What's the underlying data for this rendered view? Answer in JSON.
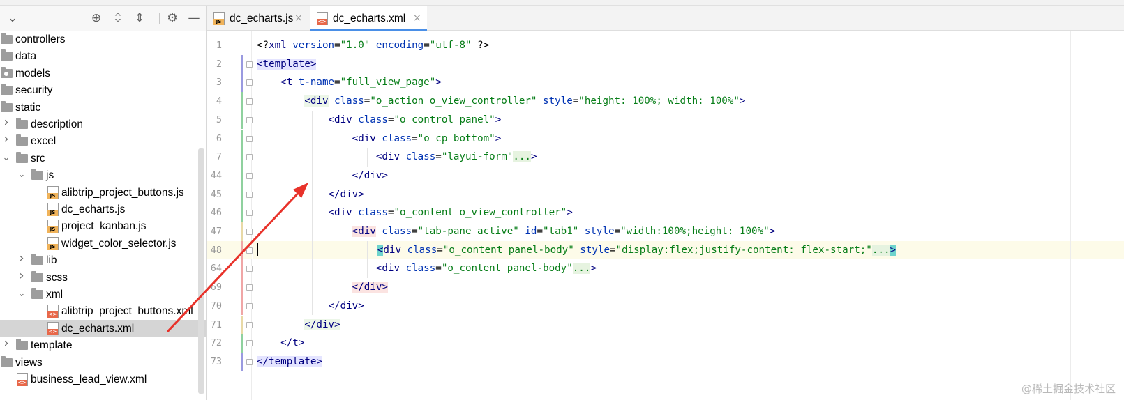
{
  "project_panel": {
    "toolbar": {
      "dropdown_icon": "chevron-down-icon",
      "locate_icon": "crosshair-icon",
      "expand_icon": "expand-all-icon",
      "collapse_icon": "collapse-all-icon",
      "settings_icon": "gear-icon",
      "hide_icon": "minimize-icon"
    },
    "tree": [
      {
        "label": "controllers",
        "type": "folder",
        "depth": 0,
        "state": "none"
      },
      {
        "label": "data",
        "type": "folder",
        "depth": 0,
        "state": "none"
      },
      {
        "label": "models",
        "type": "folder",
        "depth": 0,
        "state": "none",
        "special": true
      },
      {
        "label": "security",
        "type": "folder",
        "depth": 0,
        "state": "none"
      },
      {
        "label": "static",
        "type": "folder",
        "depth": 0,
        "state": "none"
      },
      {
        "label": "description",
        "type": "folder",
        "depth": 1,
        "state": "collapsed"
      },
      {
        "label": "excel",
        "type": "folder",
        "depth": 1,
        "state": "collapsed"
      },
      {
        "label": "src",
        "type": "folder",
        "depth": 1,
        "state": "expanded"
      },
      {
        "label": "js",
        "type": "folder",
        "depth": 2,
        "state": "expanded"
      },
      {
        "label": "alibtrip_project_buttons.js",
        "type": "js",
        "depth": 3,
        "state": "none"
      },
      {
        "label": "dc_echarts.js",
        "type": "js",
        "depth": 3,
        "state": "none"
      },
      {
        "label": "project_kanban.js",
        "type": "js",
        "depth": 3,
        "state": "none"
      },
      {
        "label": "widget_color_selector.js",
        "type": "js",
        "depth": 3,
        "state": "none"
      },
      {
        "label": "lib",
        "type": "folder",
        "depth": 2,
        "state": "collapsed"
      },
      {
        "label": "scss",
        "type": "folder",
        "depth": 2,
        "state": "collapsed"
      },
      {
        "label": "xml",
        "type": "folder",
        "depth": 2,
        "state": "expanded"
      },
      {
        "label": "alibtrip_project_buttons.xml",
        "type": "xml",
        "depth": 3,
        "state": "none"
      },
      {
        "label": "dc_echarts.xml",
        "type": "xml",
        "depth": 3,
        "state": "none",
        "selected": true
      },
      {
        "label": "template",
        "type": "folder",
        "depth": 1,
        "state": "collapsed"
      },
      {
        "label": "views",
        "type": "folder",
        "depth": 0,
        "state": "none"
      },
      {
        "label": "business_lead_view.xml",
        "type": "xml",
        "depth": 1,
        "state": "none"
      }
    ]
  },
  "editor": {
    "tabs": [
      {
        "label": "dc_echarts.js",
        "type": "js",
        "active": false
      },
      {
        "label": "dc_echarts.xml",
        "type": "xml",
        "active": true
      }
    ],
    "close_glyph": "×",
    "lines": [
      {
        "n": "1",
        "indent": 0,
        "tokens": [
          [
            "p",
            "<?"
          ],
          [
            "t",
            "xml "
          ],
          [
            "a",
            "version"
          ],
          [
            "p",
            "="
          ],
          [
            "v",
            "\"1.0\" "
          ],
          [
            "a",
            "encoding"
          ],
          [
            "p",
            "="
          ],
          [
            "v",
            "\"utf-8\""
          ],
          [
            "p",
            " ?>"
          ]
        ]
      },
      {
        "n": "2",
        "indent": 0,
        "tokens": [
          [
            "t",
            "<template>",
            "hlblue"
          ]
        ]
      },
      {
        "n": "3",
        "indent": 1,
        "tokens": [
          [
            "t",
            "<t "
          ],
          [
            "a",
            "t-name"
          ],
          [
            "p",
            "="
          ],
          [
            "v",
            "\"full_view_page\""
          ],
          [
            "t",
            ">"
          ]
        ]
      },
      {
        "n": "4",
        "indent": 2,
        "tokens": [
          [
            "t",
            "<div",
            "hlbg"
          ],
          [
            "a",
            " class"
          ],
          [
            "p",
            "="
          ],
          [
            "v",
            "\"o_action o_view_controller\" "
          ],
          [
            "a",
            "style"
          ],
          [
            "p",
            "="
          ],
          [
            "v",
            "\"height: 100%; width: 100%\""
          ],
          [
            "t",
            ">"
          ]
        ]
      },
      {
        "n": "5",
        "indent": 3,
        "tokens": [
          [
            "t",
            "<div "
          ],
          [
            "a",
            "class"
          ],
          [
            "p",
            "="
          ],
          [
            "v",
            "\"o_control_panel\""
          ],
          [
            "t",
            ">"
          ]
        ]
      },
      {
        "n": "6",
        "indent": 4,
        "tokens": [
          [
            "t",
            "<div "
          ],
          [
            "a",
            "class"
          ],
          [
            "p",
            "="
          ],
          [
            "v",
            "\"o_cp_bottom\""
          ],
          [
            "t",
            ">"
          ]
        ]
      },
      {
        "n": "7",
        "indent": 5,
        "tokens": [
          [
            "t",
            "<div "
          ],
          [
            "a",
            "class"
          ],
          [
            "p",
            "="
          ],
          [
            "v",
            "\"layui-form\""
          ],
          [
            "p",
            "...",
            "fold-ph"
          ],
          [
            "t",
            ">"
          ]
        ]
      },
      {
        "n": "44",
        "indent": 4,
        "tokens": [
          [
            "t",
            "</div>"
          ]
        ]
      },
      {
        "n": "45",
        "indent": 3,
        "tokens": [
          [
            "t",
            "</div>"
          ]
        ]
      },
      {
        "n": "46",
        "indent": 3,
        "tokens": [
          [
            "t",
            "<div "
          ],
          [
            "a",
            "class"
          ],
          [
            "p",
            "="
          ],
          [
            "v",
            "\"o_content o_view_controller\""
          ],
          [
            "t",
            ">"
          ]
        ]
      },
      {
        "n": "47",
        "indent": 4,
        "tokens": [
          [
            "t",
            "<div",
            "hlpink"
          ],
          [
            "a",
            " class"
          ],
          [
            "p",
            "="
          ],
          [
            "v",
            "\"tab-pane active\" "
          ],
          [
            "a",
            "id"
          ],
          [
            "p",
            "="
          ],
          [
            "v",
            "\"tab1\" "
          ],
          [
            "a",
            "style"
          ],
          [
            "p",
            "="
          ],
          [
            "v",
            "\"width:100%;height: 100%\""
          ],
          [
            "t",
            ">"
          ]
        ]
      },
      {
        "n": "48",
        "indent": 5,
        "tokens": [
          [
            "t",
            "<",
            "hlteal"
          ],
          [
            "t",
            "div "
          ],
          [
            "a",
            "class"
          ],
          [
            "p",
            "="
          ],
          [
            "v",
            "\"o_content panel-body\" "
          ],
          [
            "a",
            "style"
          ],
          [
            "p",
            "="
          ],
          [
            "v",
            "\"display:flex;justify-content: flex-start;\""
          ],
          [
            "p",
            "...",
            "fold-ph"
          ],
          [
            "t",
            ">",
            "hlteal"
          ]
        ],
        "current": true
      },
      {
        "n": "64",
        "indent": 5,
        "tokens": [
          [
            "t",
            "<div "
          ],
          [
            "a",
            "class"
          ],
          [
            "p",
            "="
          ],
          [
            "v",
            "\"o_content panel-body\""
          ],
          [
            "p",
            "...",
            "fold-ph"
          ],
          [
            "t",
            ">"
          ]
        ]
      },
      {
        "n": "69",
        "indent": 4,
        "tokens": [
          [
            "t",
            "</div>",
            "hlpink"
          ]
        ]
      },
      {
        "n": "70",
        "indent": 3,
        "tokens": [
          [
            "t",
            "</div>"
          ]
        ]
      },
      {
        "n": "71",
        "indent": 2,
        "tokens": [
          [
            "t",
            "</div>",
            "hlbg"
          ]
        ]
      },
      {
        "n": "72",
        "indent": 1,
        "tokens": [
          [
            "t",
            "</t>"
          ]
        ]
      },
      {
        "n": "73",
        "indent": 0,
        "tokens": [
          [
            "t",
            "</template>",
            "hlblue"
          ]
        ]
      }
    ]
  },
  "annotation": {
    "color": "#e8322a"
  },
  "watermark": "@稀土掘金技术社区"
}
